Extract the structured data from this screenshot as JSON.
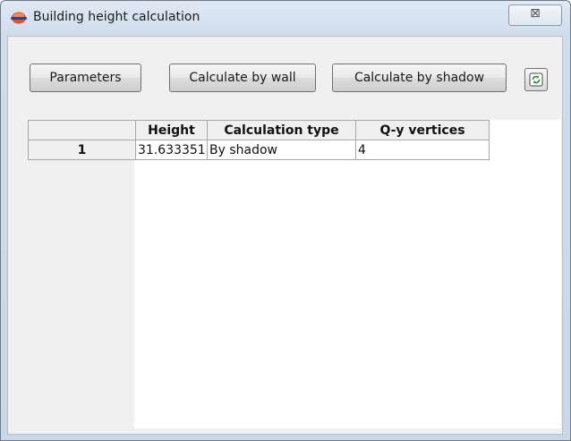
{
  "window": {
    "title": "Building height calculation",
    "close_glyph": "⊠",
    "icon": "app-sphere-icon"
  },
  "toolbar": {
    "buttons": [
      {
        "label": "Parameters"
      },
      {
        "label": "Calculate by wall"
      },
      {
        "label": "Calculate by shadow"
      }
    ],
    "refresh_icon": "refresh-icon"
  },
  "table": {
    "columns": [
      "",
      "Height",
      "Calculation type",
      "Q-y  vertices"
    ],
    "rows": [
      {
        "index": "1",
        "height": "31.633351",
        "type": "By shadow",
        "vertices": "4"
      }
    ]
  },
  "colors": {
    "accent": "#d0dcea",
    "border": "#a8a8a8"
  }
}
